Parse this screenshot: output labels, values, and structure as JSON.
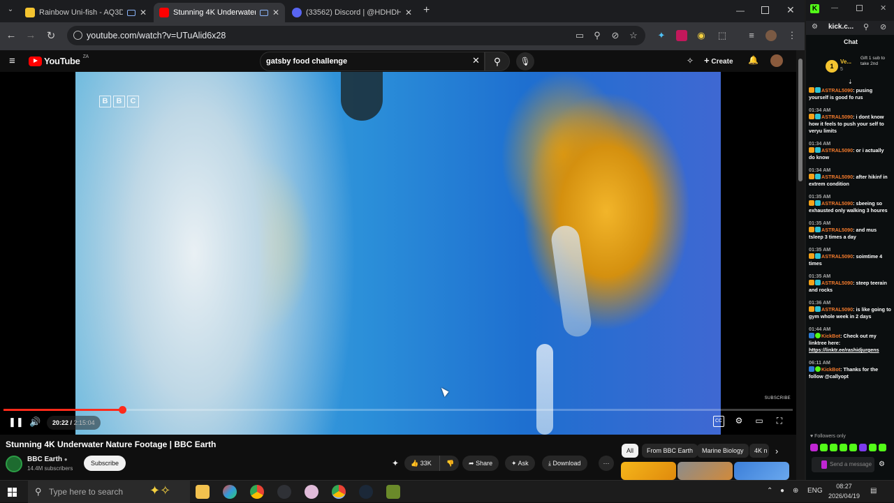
{
  "browser": {
    "tabs": [
      {
        "title": "Rainbow Uni-fish - AQ3D",
        "favicon_color": "#f4c430"
      },
      {
        "title": "Stunning 4K Underwater Na",
        "favicon_color": "#ff0000"
      },
      {
        "title": "(33562) Discord | @HDHDHDH",
        "favicon_color": "#5865f2"
      }
    ],
    "new_tab": "+",
    "url": "youtube.com/watch?v=UTuAlid6x28"
  },
  "youtube": {
    "logo_text": "YouTube",
    "logo_region": "ZA",
    "search_value": "gatsby food challenge",
    "create_label": "Create",
    "video": {
      "watermark": "SUBSCRIBE",
      "bbc_letters": [
        "B",
        "B",
        "C"
      ],
      "current_time": "20:22",
      "duration": "2:15:04",
      "progress_fraction": 0.15,
      "title": "Stunning 4K Underwater Nature Footage | BBC Earth"
    },
    "channel": {
      "name": "BBC Earth",
      "subscribers": "14.4M subscribers",
      "subscribe_label": "Subscribe"
    },
    "actions": {
      "likes": "33K",
      "share": "Share",
      "ask": "Ask",
      "download": "Download"
    },
    "chips": [
      "All",
      "From BBC Earth",
      "Marine Biology",
      "4K n"
    ]
  },
  "kick": {
    "tab_title": "kick.c...",
    "chat_header": "Chat",
    "pinned": {
      "count": "1",
      "user": "Ve...",
      "sub": "5",
      "text": "Gift 1 sub to take 2nd"
    },
    "messages": [
      {
        "time": "",
        "user": "ASTRAL5090",
        "text": ": pusing yourself is good fo rus"
      },
      {
        "time": "01:34 AM",
        "user": "ASTRAL5090",
        "text": ": i dont know how it feels to push your self to veryu limits"
      },
      {
        "time": "01:34 AM",
        "user": "ASTRAL5090",
        "text": ": or i actually do know"
      },
      {
        "time": "01:34 AM",
        "user": "ASTRAL5090",
        "text": ": after hikinf in extrem condition"
      },
      {
        "time": "01:35 AM",
        "user": "ASTRAL5090",
        "text": ": sbeeing so exhausted only walking 3 houres"
      },
      {
        "time": "01:35 AM",
        "user": "ASTRAL5090",
        "text": ": and mus tsleep 3 times a day"
      },
      {
        "time": "01:35 AM",
        "user": "ASTRAL5090",
        "text": ": soimtime 4 times"
      },
      {
        "time": "01:35 AM",
        "user": "ASTRAL5090",
        "text": ": steep teerain and rocks"
      },
      {
        "time": "01:36 AM",
        "user": "ASTRAL5090",
        "text": ": is like going to gym whole week in 2 days"
      }
    ],
    "bot_messages": [
      {
        "time": "01:44 AM",
        "user": "KickBot",
        "text": ": Check out my linktree here: ",
        "link": "https://linktr.ee/rashidjurgens"
      },
      {
        "time": "06:11 AM",
        "user": "KickBot",
        "text": ": Thanks for the follow @callyopt",
        "link": ""
      }
    ],
    "followers_only": "Followers only",
    "input_placeholder": "Send a message"
  },
  "taskbar": {
    "search_placeholder": "Type here to search",
    "language": "ENG",
    "time": "08:27",
    "date": "2026/04/19"
  }
}
